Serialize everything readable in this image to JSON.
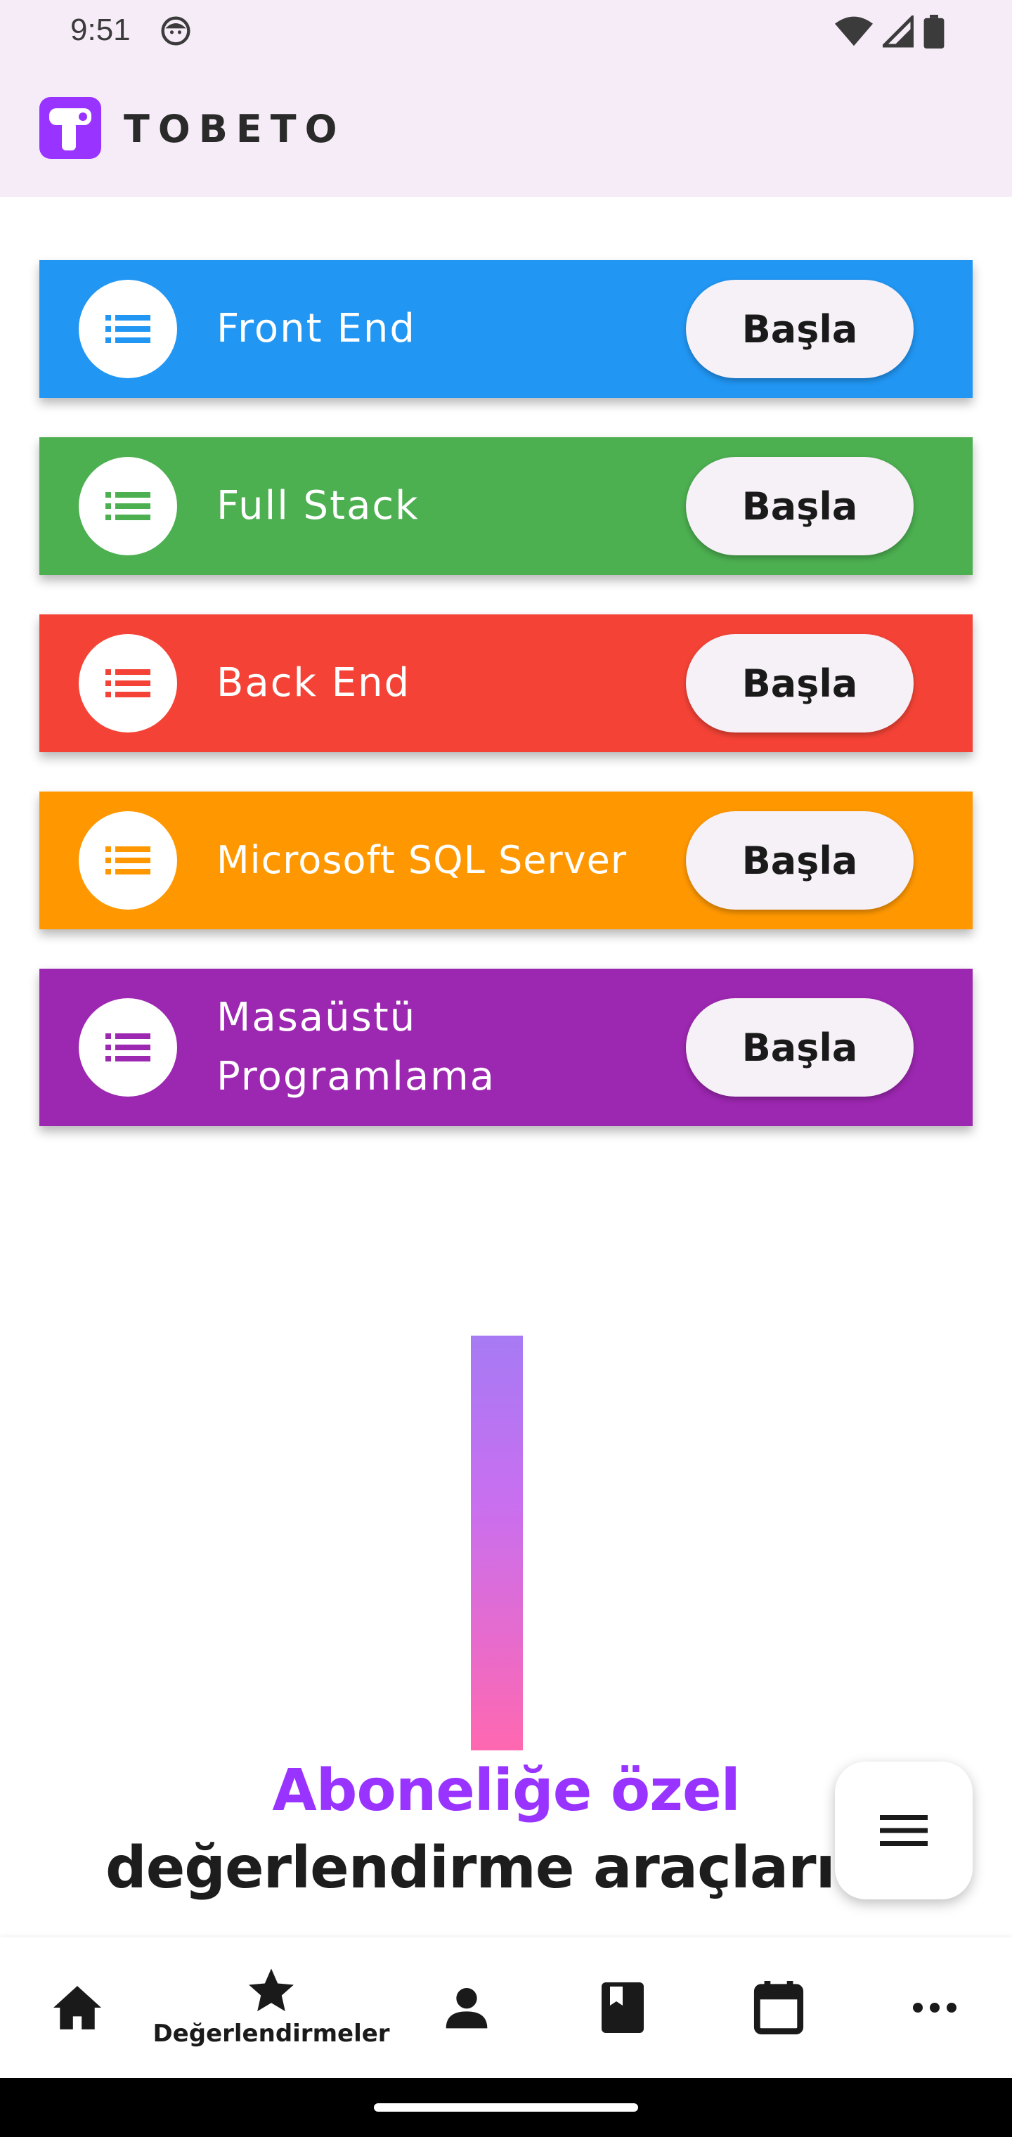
{
  "status_bar": {
    "time": "9:51"
  },
  "app_bar": {
    "brand": "TOBETO",
    "brand_color": "#9933ff"
  },
  "courses": [
    {
      "title": "Front End",
      "button": "Başla",
      "color": "#2196f3"
    },
    {
      "title": "Full Stack",
      "button": "Başla",
      "color": "#4caf50"
    },
    {
      "title": "Back End",
      "button": "Başla",
      "color": "#f44336"
    },
    {
      "title": "Microsoft SQL Server",
      "button": "Başla",
      "color": "#ff9800"
    },
    {
      "title_line1": "Masaüstü",
      "title_line2": "Programlama",
      "button": "Başla",
      "color": "#9c27b0"
    }
  ],
  "promo": {
    "line1": "Aboneliğe özel",
    "line2": "değerlendirme araçları için"
  },
  "bottom_nav": {
    "items": [
      {
        "icon": "home-icon",
        "label": ""
      },
      {
        "icon": "star-icon",
        "label": "Değerlendirmeler",
        "selected": true
      },
      {
        "icon": "person-icon",
        "label": ""
      },
      {
        "icon": "book-icon",
        "label": ""
      },
      {
        "icon": "calendar-icon",
        "label": ""
      },
      {
        "icon": "more-icon",
        "label": ""
      }
    ]
  },
  "fab": {
    "icon": "menu-icon"
  }
}
